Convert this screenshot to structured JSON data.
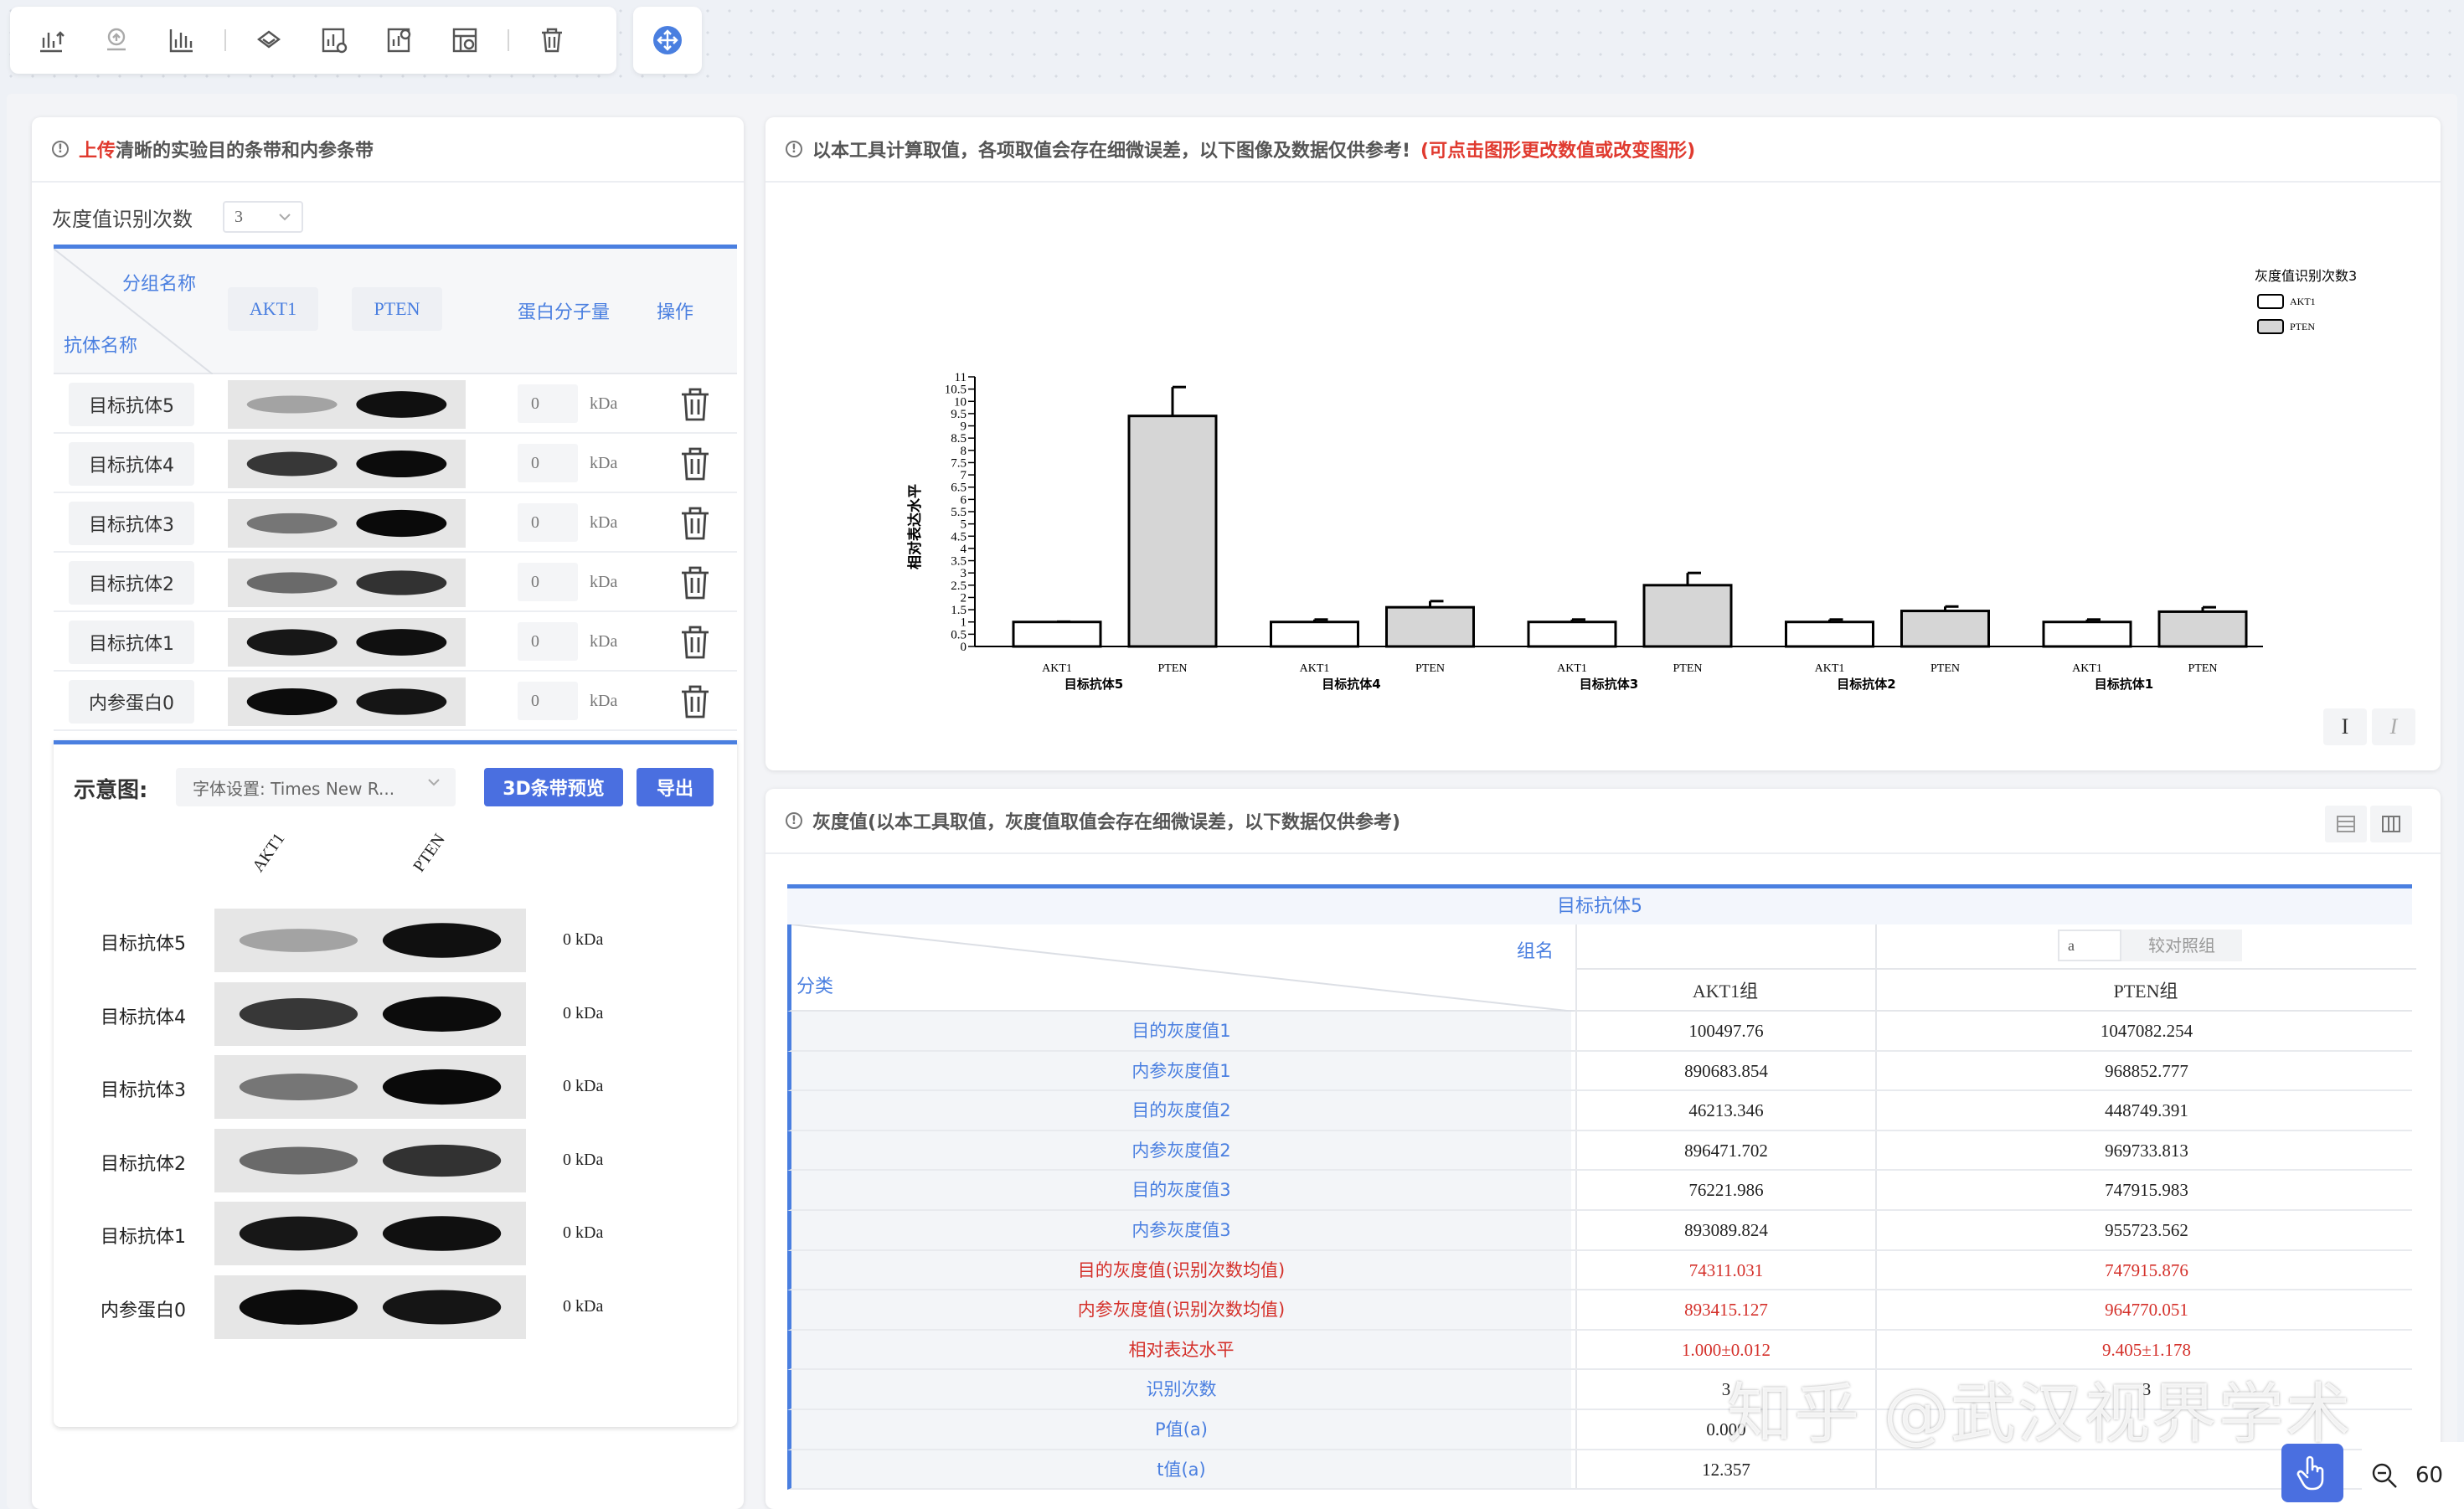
{
  "left": {
    "header_red": "上传",
    "header_rest": "清晰的实验目的条带和内参条带",
    "count_label": "灰度值识别次数",
    "count_value": "3",
    "table": {
      "group_label": "分组名称",
      "antibody_label": "抗体名称",
      "columns": [
        "AKT1",
        "PTEN"
      ],
      "mw_header": "蛋白分子量",
      "op_header": "操作",
      "rows": [
        {
          "name": "目标抗体5",
          "mw": "0",
          "unit": "kDa"
        },
        {
          "name": "目标抗体4",
          "mw": "0",
          "unit": "kDa"
        },
        {
          "name": "目标抗体3",
          "mw": "0",
          "unit": "kDa"
        },
        {
          "name": "目标抗体2",
          "mw": "0",
          "unit": "kDa"
        },
        {
          "name": "目标抗体1",
          "mw": "0",
          "unit": "kDa"
        },
        {
          "name": "内参蛋白0",
          "mw": "0",
          "unit": "kDa"
        }
      ]
    },
    "preview": {
      "title": "示意图:",
      "font_setting": "字体设置: Times New R...",
      "btn_3d": "3D条带预览",
      "btn_export": "导出",
      "cols": [
        "AKT1",
        "PTEN"
      ],
      "rows": [
        {
          "name": "目标抗体5",
          "kda": "0 kDa"
        },
        {
          "name": "目标抗体4",
          "kda": "0 kDa"
        },
        {
          "name": "目标抗体3",
          "kda": "0 kDa"
        },
        {
          "name": "目标抗体2",
          "kda": "0 kDa"
        },
        {
          "name": "目标抗体1",
          "kda": "0 kDa"
        },
        {
          "name": "内参蛋白0",
          "kda": "0 kDa"
        }
      ]
    }
  },
  "chart_panel": {
    "header": "以本工具计算取值，各项取值会存在细微误差，以下图像及数据仅供参考!",
    "header_red": "(可点击图形更改数值或改变图形)",
    "cursor_tools": [
      "I",
      "I"
    ]
  },
  "chart_data": {
    "type": "bar",
    "ylabel": "相对表达水平",
    "ylim": [
      0,
      11
    ],
    "yticks": [
      "0",
      "0.5",
      "1",
      "1.5",
      "2",
      "2.5",
      "3",
      "3.5",
      "4",
      "4.5",
      "5",
      "5.5",
      "6",
      "6.5",
      "7",
      "7.5",
      "8",
      "8.5",
      "9",
      "9.5",
      "10",
      "10.5",
      "11"
    ],
    "groups": [
      "目标抗体5",
      "目标抗体4",
      "目标抗体3",
      "目标抗体2",
      "目标抗体1"
    ],
    "bar_labels": [
      "AKT1",
      "PTEN"
    ],
    "series": [
      {
        "name": "AKT1",
        "color": "#ffffff",
        "values": [
          1.0,
          1.0,
          1.0,
          1.0,
          1.0
        ],
        "errors": [
          0.012,
          0.1,
          0.1,
          0.1,
          0.1
        ]
      },
      {
        "name": "PTEN",
        "color": "#d6d6d6",
        "values": [
          9.405,
          1.6,
          2.5,
          1.45,
          1.42
        ],
        "errors": [
          1.178,
          0.25,
          0.5,
          0.18,
          0.18
        ]
      }
    ],
    "legend_title": "灰度值识别次数3",
    "legend_position": "top-right"
  },
  "gray_panel": {
    "header": "灰度值(以本工具取值，灰度值取值会存在细微误差，以下数据仅供参考)",
    "table_title": "目标抗体5",
    "group_label": "组名",
    "category_label": "分类",
    "input_value": "a",
    "ref_label": "较对照组",
    "col1": "AKT1组",
    "col2": "PTEN组",
    "rows": [
      {
        "k": "目的灰度值1",
        "v1": "100497.76",
        "v2": "1047082.254",
        "red": false
      },
      {
        "k": "内参灰度值1",
        "v1": "890683.854",
        "v2": "968852.777",
        "red": false
      },
      {
        "k": "目的灰度值2",
        "v1": "46213.346",
        "v2": "448749.391",
        "red": false
      },
      {
        "k": "内参灰度值2",
        "v1": "896471.702",
        "v2": "969733.813",
        "red": false
      },
      {
        "k": "目的灰度值3",
        "v1": "76221.986",
        "v2": "747915.983",
        "red": false
      },
      {
        "k": "内参灰度值3",
        "v1": "893089.824",
        "v2": "955723.562",
        "red": false
      },
      {
        "k": "目的灰度值(识别次数均值)",
        "v1": "74311.031",
        "v2": "747915.876",
        "red": true
      },
      {
        "k": "内参灰度值(识别次数均值)",
        "v1": "893415.127",
        "v2": "964770.051",
        "red": true
      },
      {
        "k": "相对表达水平",
        "v1": "1.000±0.012",
        "v2": "9.405±1.178",
        "red": true
      },
      {
        "k": "识别次数",
        "v1": "3",
        "v2": "3",
        "red": false
      },
      {
        "k": "P值(a)",
        "v1": "0.000",
        "v2": "",
        "red": false
      },
      {
        "k": "t值(a)",
        "v1": "12.357",
        "v2": "",
        "red": false
      }
    ]
  },
  "watermark": "知乎 @武汉视界学术",
  "zoom": "60"
}
